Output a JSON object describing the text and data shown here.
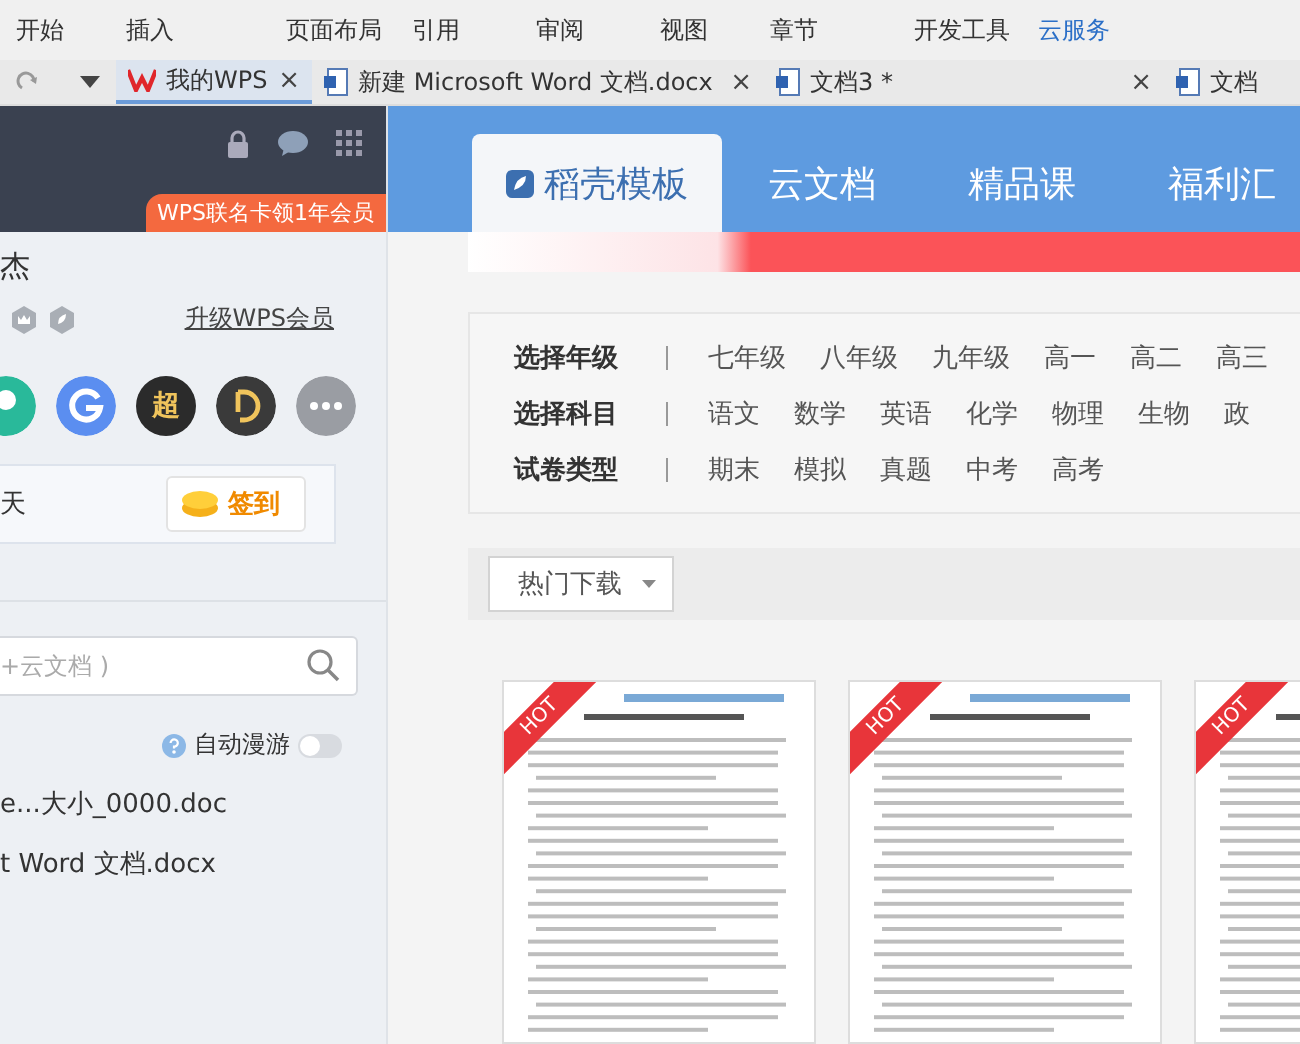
{
  "menu": [
    {
      "label": "开始",
      "selected": false
    },
    {
      "label": "插入",
      "selected": false
    },
    {
      "label": "页面布局",
      "selected": false
    },
    {
      "label": "引用",
      "selected": false
    },
    {
      "label": "审阅",
      "selected": false
    },
    {
      "label": "视图",
      "selected": false
    },
    {
      "label": "章节",
      "selected": false
    },
    {
      "label": "开发工具",
      "selected": false
    },
    {
      "label": "云服务",
      "selected": true
    }
  ],
  "doc_tabs": [
    {
      "kind": "home",
      "label": "我的WPS",
      "selected": true,
      "close": "×"
    },
    {
      "kind": "doc",
      "label": "新建 Microsoft Word 文档.docx",
      "selected": false,
      "close": "×"
    },
    {
      "kind": "doc",
      "label": "文档3 *",
      "selected": false,
      "close": "×"
    },
    {
      "kind": "doc",
      "label": "文档",
      "selected": false
    }
  ],
  "sidebar": {
    "promo": "WPS联名卡领1年会员",
    "user_name": "杰",
    "upgrade_link": "升级WPS会员",
    "apps": [
      {
        "kind": "teal"
      },
      {
        "kind": "g"
      },
      {
        "kind": "text",
        "label": "超"
      },
      {
        "kind": "d"
      },
      {
        "kind": "more"
      }
    ],
    "checkin": {
      "text": "天",
      "button": "签到"
    },
    "search": {
      "placeholder": "+云文档 )"
    },
    "auto_roam": {
      "label": "自动漫游",
      "on": false
    },
    "recent_files": [
      "e...大小_0000.doc",
      "t Word 文档.docx"
    ]
  },
  "main": {
    "tabs": [
      {
        "label": "稻壳模板",
        "selected": true
      },
      {
        "label": "云文档",
        "selected": false
      },
      {
        "label": "精品课",
        "selected": false
      },
      {
        "label": "福利汇",
        "selected": false
      }
    ],
    "filters": [
      {
        "label": "选择年级",
        "options": [
          "七年级",
          "八年级",
          "九年级",
          "高一",
          "高二",
          "高三"
        ]
      },
      {
        "label": "选择科目",
        "options": [
          "语文",
          "数学",
          "英语",
          "化学",
          "物理",
          "生物",
          "政"
        ]
      },
      {
        "label": "试卷类型",
        "options": [
          "期末",
          "模拟",
          "真题",
          "中考",
          "高考"
        ]
      }
    ],
    "sort": {
      "label": "热门下载"
    },
    "documents": [
      {
        "badge": "HOT"
      },
      {
        "badge": "HOT"
      },
      {
        "badge": "HOT"
      }
    ]
  }
}
